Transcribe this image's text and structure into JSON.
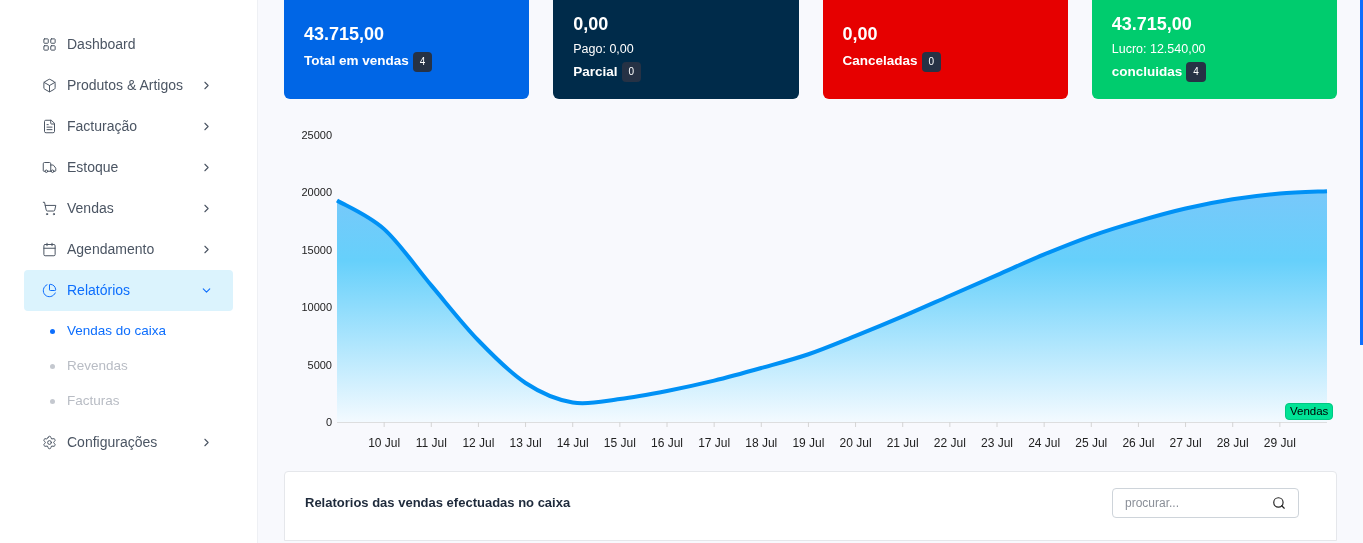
{
  "sidebar": {
    "items": [
      {
        "label": "Dashboard",
        "selected": false
      },
      {
        "label": "Produtos & Artigos",
        "expanded": false,
        "selected": false
      },
      {
        "label": "Facturação",
        "expanded": false,
        "selected": false
      },
      {
        "label": "Estoque",
        "expanded": false,
        "selected": false
      },
      {
        "label": "Vendas",
        "expanded": false,
        "selected": false
      },
      {
        "label": "Agendamento",
        "expanded": false,
        "selected": false
      },
      {
        "label": "Relatórios",
        "expanded": true,
        "selected": true,
        "children": [
          {
            "label": "Vendas do caixa",
            "selected": true
          },
          {
            "label": "Revendas",
            "selected": false
          },
          {
            "label": "Facturas",
            "selected": false
          }
        ]
      },
      {
        "label": "Configurações",
        "expanded": false,
        "selected": false
      }
    ]
  },
  "cards": [
    {
      "value": "43.715,00",
      "label": "Total em vendas",
      "count": "4",
      "color": "#0066e6"
    },
    {
      "value": "0,00",
      "sub": "Pago: 0,00",
      "label": "Parcial",
      "count": "0",
      "color": "#002b4a"
    },
    {
      "value": "0,00",
      "label": "Canceladas",
      "count": "0",
      "color": "#e60000"
    },
    {
      "value": "43.715,00",
      "sub": "Lucro: 12.540,00",
      "label": "concluidas",
      "count": "4",
      "color": "#00cc6e"
    }
  ],
  "chart": {
    "chart_data": {
      "type": "area",
      "ylim": [
        0,
        25000
      ],
      "categories": [
        null,
        "10 Jul",
        "11 Jul",
        "12 Jul",
        "13 Jul",
        "14 Jul",
        "15 Jul",
        "16 Jul",
        "17 Jul",
        "18 Jul",
        "19 Jul",
        "20 Jul",
        "21 Jul",
        "22 Jul",
        "23 Jul",
        "24 Jul",
        "25 Jul",
        "26 Jul",
        "27 Jul",
        "28 Jul",
        "29 Jul",
        null
      ],
      "yticks": [
        0,
        5000,
        10000,
        15000,
        20000,
        25000
      ],
      "series": [
        {
          "name": "Vendas",
          "color": "#0091f5",
          "values": [
            19300,
            16800,
            11900,
            7100,
            3400,
            1700,
            2000,
            2700,
            3600,
            4700,
            5900,
            7500,
            9200,
            11000,
            12800,
            14600,
            16200,
            17500,
            18600,
            19400,
            19900,
            20100
          ]
        }
      ]
    }
  },
  "report": {
    "title": "Relatorios das vendas efectuadas no caixa",
    "search": {
      "placeholder": "procurar..."
    }
  }
}
